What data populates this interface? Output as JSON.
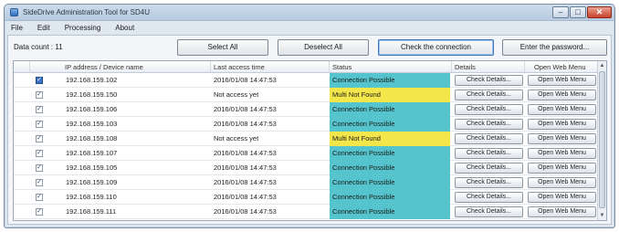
{
  "window": {
    "title": "SideDrive Administration Tool for SD4U"
  },
  "menu": [
    {
      "label": "File"
    },
    {
      "label": "Edit"
    },
    {
      "label": "Processing"
    },
    {
      "label": "About"
    }
  ],
  "toolbar": {
    "data_count": "Data count : 11",
    "select_all": "Select All",
    "deselect_all": "Deselect All",
    "check_connection": "Check the connection",
    "enter_password": "Enter the password..."
  },
  "table": {
    "columns": [
      "IP address / Device name",
      "Last access time",
      "Status",
      "Details",
      "Open Web Menu"
    ],
    "details_button": "Check Details...",
    "webmenu_button": "Open Web Menu",
    "rows": [
      {
        "ip": "192.168.159.102",
        "time": "2016/01/08 14:47:53",
        "status": "Connection Possible",
        "checked": true,
        "highlight": true
      },
      {
        "ip": "192.168.159.150",
        "time": "Not access yet",
        "status": "Multi Not Found",
        "checked": true,
        "highlight": false
      },
      {
        "ip": "192.168.159.106",
        "time": "2016/01/08 14:47:53",
        "status": "Connection Possible",
        "checked": true,
        "highlight": false
      },
      {
        "ip": "192.168.159.103",
        "time": "2016/01/08 14:47:53",
        "status": "Connection Possible",
        "checked": true,
        "highlight": false
      },
      {
        "ip": "192.168.159.108",
        "time": "Not access yet",
        "status": "Multi Not Found",
        "checked": true,
        "highlight": false
      },
      {
        "ip": "192.168.159.107",
        "time": "2016/01/08 14:47:53",
        "status": "Connection Possible",
        "checked": true,
        "highlight": false
      },
      {
        "ip": "192.168.159.105",
        "time": "2016/01/08 14:47:53",
        "status": "Connection Possible",
        "checked": true,
        "highlight": false
      },
      {
        "ip": "192.168.159.109",
        "time": "2016/01/08 14:47:53",
        "status": "Connection Possible",
        "checked": true,
        "highlight": false
      },
      {
        "ip": "192.168.159.110",
        "time": "2016/01/08 14:47:53",
        "status": "Connection Possible",
        "checked": true,
        "highlight": false
      },
      {
        "ip": "192.168.159.111",
        "time": "2016/01/08 14:47:53",
        "status": "Connection Possible",
        "checked": true,
        "highlight": false
      }
    ]
  },
  "colors": {
    "status_connected": "#55c4cc",
    "status_not_found": "#f2e64a"
  },
  "icons": {
    "app": "app-icon",
    "minimize": "minimize-icon",
    "maximize": "maximize-icon",
    "close": "close-icon",
    "checkbox": "checkbox-icon",
    "scroll_up": "chevron-up-icon",
    "scroll_down": "chevron-down-icon"
  }
}
